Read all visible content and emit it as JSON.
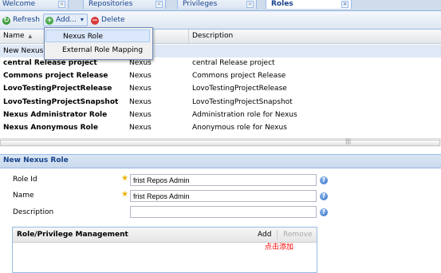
{
  "tabs": [
    {
      "label": "Welcome",
      "active": false
    },
    {
      "label": "Repositories",
      "active": false
    },
    {
      "label": "Privileges",
      "active": false
    },
    {
      "label": "Roles",
      "active": true
    }
  ],
  "tab_close_glyph": "×",
  "toolbar": {
    "refresh_label": "Refresh",
    "add_label": "Add...",
    "add_caret": "▾",
    "delete_label": "Delete",
    "icons": {
      "refresh": "refresh-icon",
      "add": "add-icon",
      "delete": "delete-icon"
    }
  },
  "add_menu": {
    "items": [
      "Nexus Role",
      "External Role Mapping"
    ]
  },
  "grid": {
    "columns": [
      "Name",
      "Description"
    ],
    "sort_glyph": "▲",
    "new_row_label": "New Nexus",
    "rows": [
      {
        "name": "central Release project",
        "realm": "Nexus",
        "description": "central Release project"
      },
      {
        "name": "Commons project Release",
        "realm": "Nexus",
        "description": "Commons project Release"
      },
      {
        "name": "LovoTestingProjectRelease",
        "realm": "Nexus",
        "description": "LovoTestingProjectRelease"
      },
      {
        "name": "LovoTestingProjectSnapshot",
        "realm": "Nexus",
        "description": "LovoTestingProjectSnapshot"
      },
      {
        "name": "Nexus Administrator Role",
        "realm": "Nexus",
        "description": "Administration role for Nexus"
      },
      {
        "name": "Nexus Anonymous Role",
        "realm": "Nexus",
        "description": "Anonymous role for Nexus"
      }
    ]
  },
  "scroll_grip": "|||",
  "form": {
    "title": "New Nexus Role",
    "required_glyph": "★",
    "help_glyph": "?",
    "fields": {
      "role_id": {
        "label": "Role Id",
        "value": "frist Repos Admin"
      },
      "name": {
        "label": "Name",
        "value": "frist Repos Admin"
      },
      "description": {
        "label": "Description",
        "value": ""
      }
    },
    "role_mgmt": {
      "title": "Role/Privilege Management",
      "add_label": "Add",
      "remove_label": "Remove",
      "annotation": "点击添加"
    }
  },
  "colors": {
    "annotation": "#ff0000",
    "accent": "#15428b"
  }
}
